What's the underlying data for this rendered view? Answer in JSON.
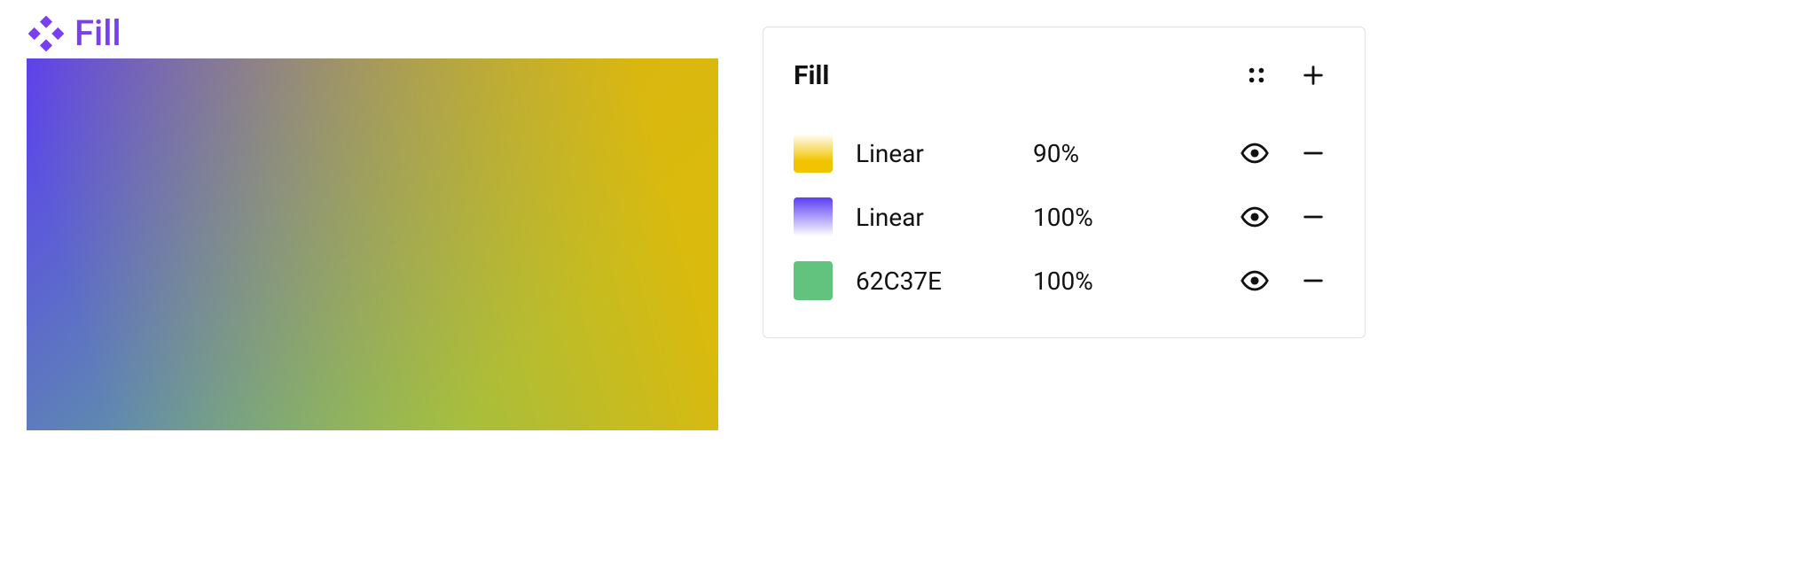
{
  "canvas": {
    "label": "Fill",
    "layers": {
      "solid": {
        "color": "#62C37E"
      },
      "purple": {
        "from": "#5a3df2",
        "to": "transparent",
        "opacity": 1.0
      },
      "yellow": {
        "from": "#e8b900",
        "to": "transparent",
        "opacity": 0.9
      }
    }
  },
  "panel": {
    "title": "Fill",
    "fills": [
      {
        "label": "Linear",
        "opacity": "90%"
      },
      {
        "label": "Linear",
        "opacity": "100%"
      },
      {
        "label": "62C37E",
        "opacity": "100%"
      }
    ]
  }
}
